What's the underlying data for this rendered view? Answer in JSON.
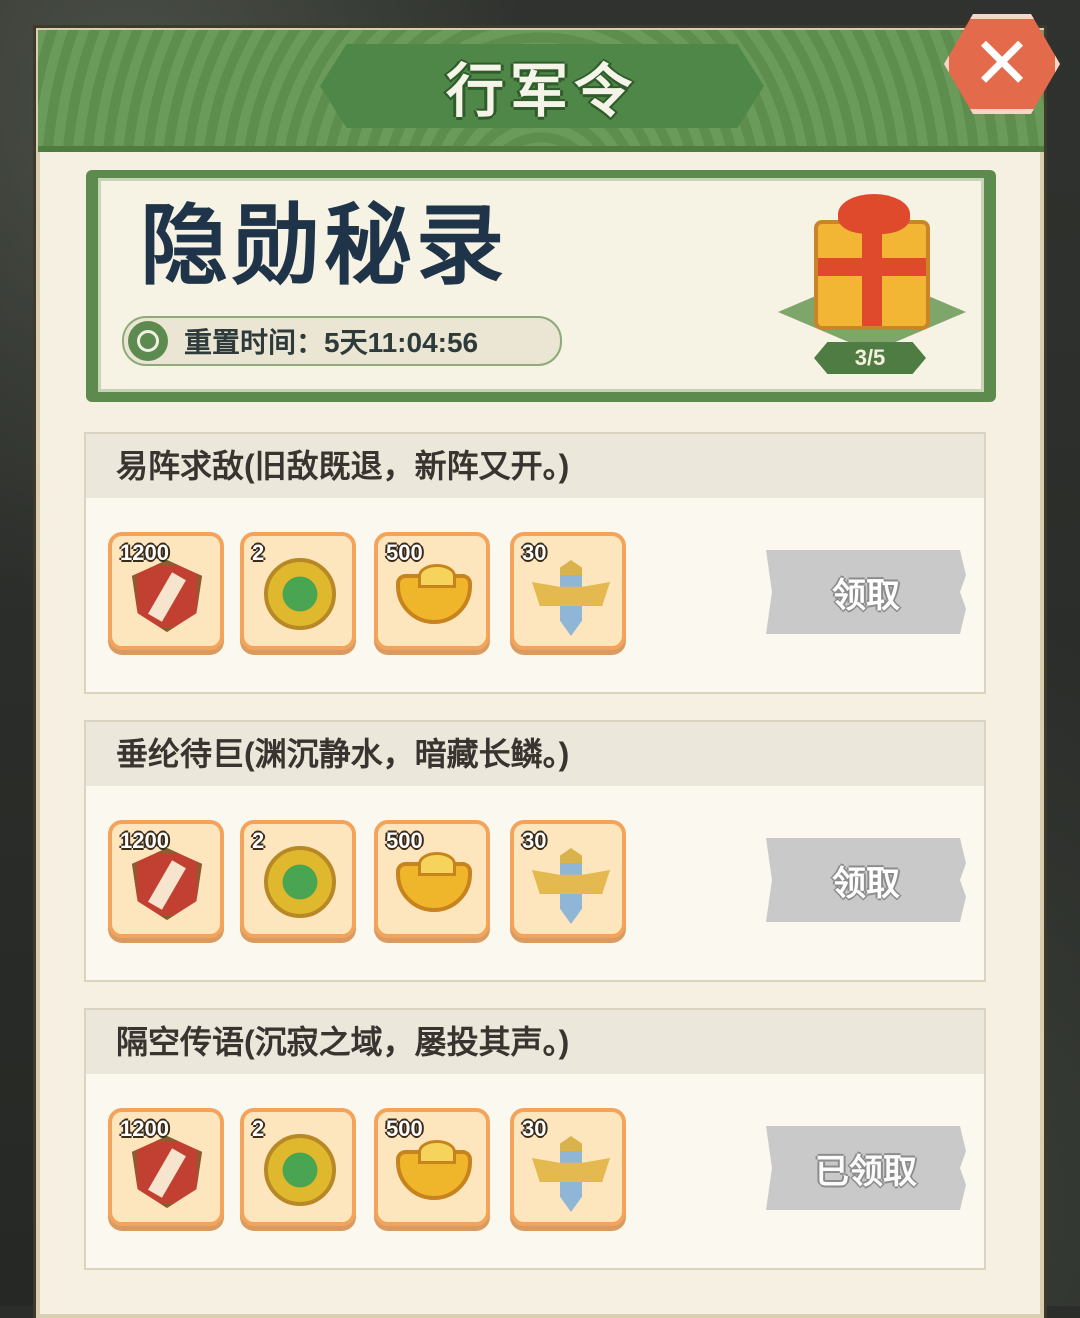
{
  "header": {
    "title": "行军令"
  },
  "banner": {
    "title": "隐勋秘录",
    "reset_label": "重置时间：5天11:04:56",
    "chest_progress": "3/5"
  },
  "tasks": [
    {
      "title": "易阵求敌(旧敌既退，新阵又开。)",
      "rewards": [
        {
          "qty": "1200",
          "icon": "shield-token-icon"
        },
        {
          "qty": "2",
          "icon": "jade-coin-icon"
        },
        {
          "qty": "500",
          "icon": "gold-ingot-icon"
        },
        {
          "qty": "30",
          "icon": "sword-emblem-icon"
        }
      ],
      "button": "领取"
    },
    {
      "title": "垂纶待巨(渊沉静水，暗藏长鳞。)",
      "rewards": [
        {
          "qty": "1200",
          "icon": "shield-token-icon"
        },
        {
          "qty": "2",
          "icon": "jade-coin-icon"
        },
        {
          "qty": "500",
          "icon": "gold-ingot-icon"
        },
        {
          "qty": "30",
          "icon": "sword-emblem-icon"
        }
      ],
      "button": "领取"
    },
    {
      "title": "隔空传语(沉寂之域，屡投其声。)",
      "rewards": [
        {
          "qty": "1200",
          "icon": "shield-token-icon"
        },
        {
          "qty": "2",
          "icon": "jade-coin-icon"
        },
        {
          "qty": "500",
          "icon": "gold-ingot-icon"
        },
        {
          "qty": "30",
          "icon": "sword-emblem-icon"
        }
      ],
      "button": "已领取"
    }
  ],
  "colors": {
    "header_green": "#5d8e4e",
    "close_red": "#e36b4b",
    "panel_cream": "#f5f0e1",
    "reward_border": "#f3a45a",
    "button_gray": "#c9c9c9"
  }
}
